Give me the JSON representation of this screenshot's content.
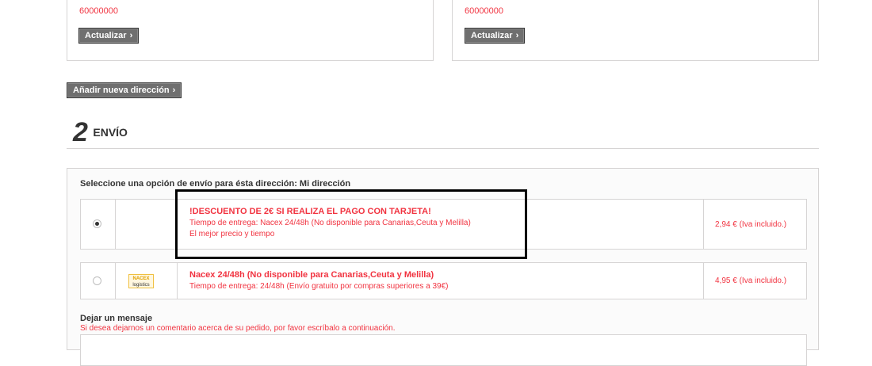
{
  "addresses": [
    {
      "phone": "60000000",
      "update_label": "Actualizar",
      "chevron": "chevron-right-icon"
    },
    {
      "phone": "60000000",
      "update_label": "Actualizar",
      "chevron": "chevron-right-icon"
    }
  ],
  "add_address_label": "Añadir nueva dirección",
  "step": {
    "number": "2",
    "title": "ENVÍO"
  },
  "shipping": {
    "prompt": "Seleccione una opción de envío para ésta dirección: Mi dirección",
    "options": [
      {
        "selected": true,
        "title": "!DESCUENTO DE 2€ SI REALIZA EL PAGO CON TARJETA!",
        "line1": "Tiempo de entrega: Nacex 24/48h (No disponible para Canarias,Ceuta y Melilla)",
        "line2": "El mejor precio y tiempo",
        "price": "2,94 € (Iva incluido.)"
      },
      {
        "selected": false,
        "logo_label": "NACEX",
        "logo_sub": "logistics",
        "title": "Nacex 24/48h (No disponible para Canarias,Ceuta y Melilla)",
        "line1": "Tiempo de entrega: 24/48h (Envío gratuito por compras superiores a 39€)",
        "price": "4,95 € (Iva incluido.)"
      }
    ]
  },
  "message": {
    "label": "Dejar un mensaje",
    "hint": "Si desea dejarnos un comentario acerca de su pedido, por favor escríbalo a continuación."
  },
  "colors": {
    "accent": "#f13340",
    "button": "#6f6f6f",
    "border": "#d6d4d4"
  }
}
